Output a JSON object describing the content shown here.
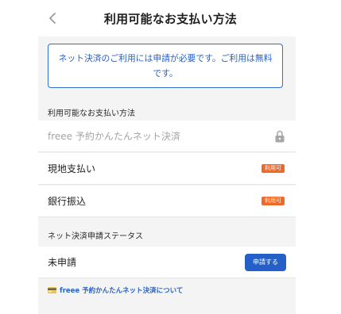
{
  "header": {
    "title": "利用可能なお支払い方法",
    "back_icon": "chevron-left-icon"
  },
  "notice": {
    "text": "ネット決済のご利用には申請が必要です。ご利用は無料です。"
  },
  "payment_section": {
    "label": "利用可能なお支払い方法",
    "items": [
      {
        "label": "freee 予約かんたんネット決済",
        "state": "locked",
        "icon": "lock-icon"
      },
      {
        "label": "現地支払い",
        "badge": "利用可"
      },
      {
        "label": "銀行振込",
        "badge": "利用可"
      }
    ]
  },
  "status_section": {
    "label": "ネット決済申請ステータス",
    "status": "未申請",
    "apply_button": "申請する"
  },
  "info_link": {
    "icon": "credit-card-icon",
    "text": "freee 予約かんたんネット決済について"
  },
  "colors": {
    "accent": "#2560c8",
    "badge": "#ee6a2b",
    "background": "#f4f4f4"
  }
}
